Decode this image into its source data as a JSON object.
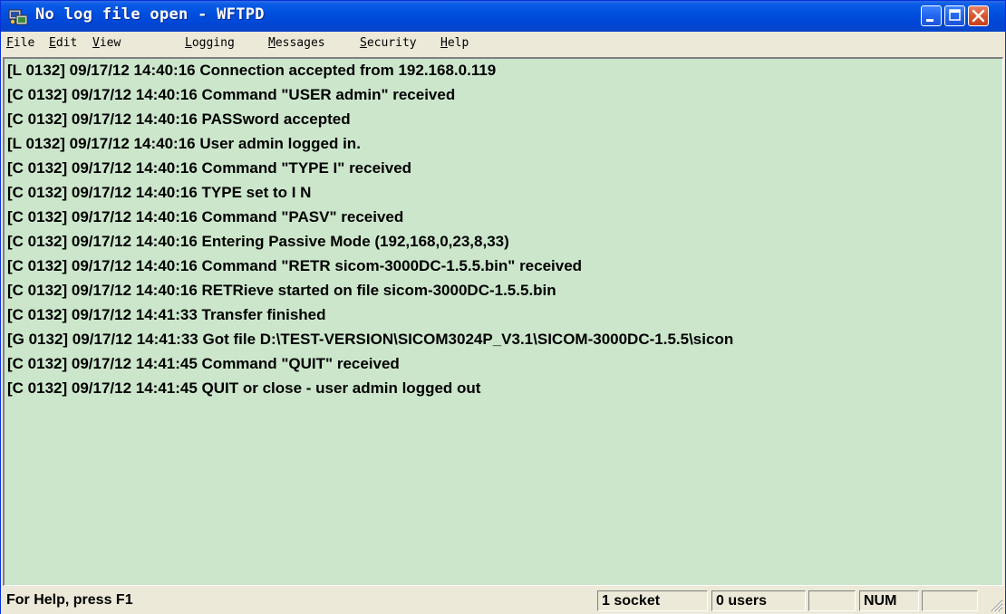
{
  "window": {
    "title": "No log file open - WFTPD"
  },
  "menu": [
    "File",
    "Edit",
    "View",
    "Logging",
    "Messages",
    "Security",
    "Help"
  ],
  "log": [
    "[L 0132] 09/17/12 14:40:16 Connection accepted from 192.168.0.119",
    "[C 0132] 09/17/12 14:40:16 Command \"USER admin\" received",
    "[C 0132] 09/17/12 14:40:16 PASSword accepted",
    "[L 0132] 09/17/12 14:40:16 User admin logged in.",
    "[C 0132] 09/17/12 14:40:16 Command \"TYPE I\" received",
    "[C 0132] 09/17/12 14:40:16 TYPE set to I N",
    "[C 0132] 09/17/12 14:40:16 Command \"PASV\" received",
    "[C 0132] 09/17/12 14:40:16 Entering Passive Mode (192,168,0,23,8,33)",
    "[C 0132] 09/17/12 14:40:16 Command \"RETR sicom-3000DC-1.5.5.bin\" received",
    "[C 0132] 09/17/12 14:40:16 RETRieve started on file sicom-3000DC-1.5.5.bin",
    "[C 0132] 09/17/12 14:41:33 Transfer finished",
    "[G 0132] 09/17/12 14:41:33 Got file D:\\TEST-VERSION\\SICOM3024P_V3.1\\SICOM-3000DC-1.5.5\\sicon",
    "[C 0132] 09/17/12 14:41:45 Command \"QUIT\" received",
    "[C 0132] 09/17/12 14:41:45 QUIT or close - user admin logged out"
  ],
  "status": {
    "help": "For Help, press F1",
    "sockets": "1 socket",
    "users": "0 users",
    "blank1": "",
    "num": "NUM",
    "blank2": ""
  },
  "colors": {
    "log_background": "#cce6cc",
    "title_bar": "#0054e3",
    "close_button": "#d9552f"
  }
}
